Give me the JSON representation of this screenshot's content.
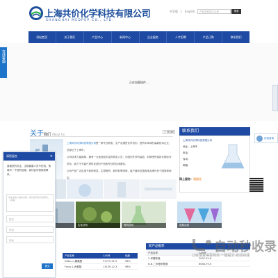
{
  "header": {
    "company_cn": "上海共价化学科技有限公司",
    "company_en": "SHANGHAI MEDPEP CO., LTD.",
    "lang_cn": "中文版",
    "lang_en": "English",
    "search_placeholder": "产品名称或CAS号",
    "search_button": "搜索"
  },
  "nav": {
    "items": [
      "网站首页",
      "关于我们",
      "产品中心",
      "新闻中心",
      "企业服务",
      "人才招聘",
      "产品订购",
      "联系我们"
    ]
  },
  "banner": {
    "message": "正在加载插件..."
  },
  "left_float": {
    "label": "在线客服"
  },
  "about": {
    "title": "关于",
    "title_sub": "我们",
    "title_en": "About Us",
    "more": "+ MORE",
    "company_link": "上海共价化学科技有限公司",
    "para1": "是一家专业研发、生产及销售化学试剂、医药中间体的高新技术企业，总部位于上海市，",
    "para2": "公司技术力量雄厚，拥有一大批经验丰富的研发人员，与国内外多所高校、科研院所保持长期合作关系，致力于为客户提供优质的产品和专业的技术服务。",
    "para3": "公司产品广泛应用于新药研发、生物医药、新材料等领域，客户遍布全国各地及海外多个国家和地区。"
  },
  "contact": {
    "title": "联系我们",
    "company": "上海共价化学科技有限公司",
    "address": "地址：上海市",
    "phone": "电话：",
    "fax": "传真：",
    "email": "邮箱：",
    "more_prefix": "网上服务：",
    "more_link": "请留言",
    "avatar_label": "在线咨询"
  },
  "products": {
    "captions": [
      "药物中间体",
      "生化试剂",
      "有机试剂",
      "定制合成"
    ]
  },
  "table_left": {
    "headers": [
      "产品名称",
      "CAS号",
      "纯度"
    ],
    "rows": [
      [
        "N-Boc-L-脯氨酸",
        "51779-32-9",
        "98%"
      ],
      [
        "Fmoc-L-丙氨酸",
        "13139-12-3",
        "98%"
      ]
    ]
  },
  "new_products": {
    "title": "新产品推荐",
    "headers": [
      "产品名称",
      "CAS号",
      ""
    ],
    "rows": [
      [
        "2-甲基咪唑",
        "2007-42-8",
        ""
      ],
      [
        "N,N-二甲基甲酰胺",
        "6638-79-5",
        ""
      ]
    ]
  },
  "chat": {
    "title": "请您留言",
    "close": "×",
    "message": "感谢您的关注，当前客服人员不在线，请填写一下您的信息，我们会尽快和您联系。",
    "textarea_placeholder": "请在此输入留言内容，我们会尽快与您联系。（必填）",
    "name_placeholder": "姓名",
    "phone_placeholder": "电话",
    "address_placeholder": "地址",
    "send": "提交"
  },
  "watermark": {
    "brand": "自动秒收录",
    "slogan": "让收录变得更简单·一键提交·自动完成"
  },
  "colors": {
    "nav_blue": "#1e4aa3",
    "accent_blue": "#1d74c8",
    "link_orange": "#e36d00"
  }
}
